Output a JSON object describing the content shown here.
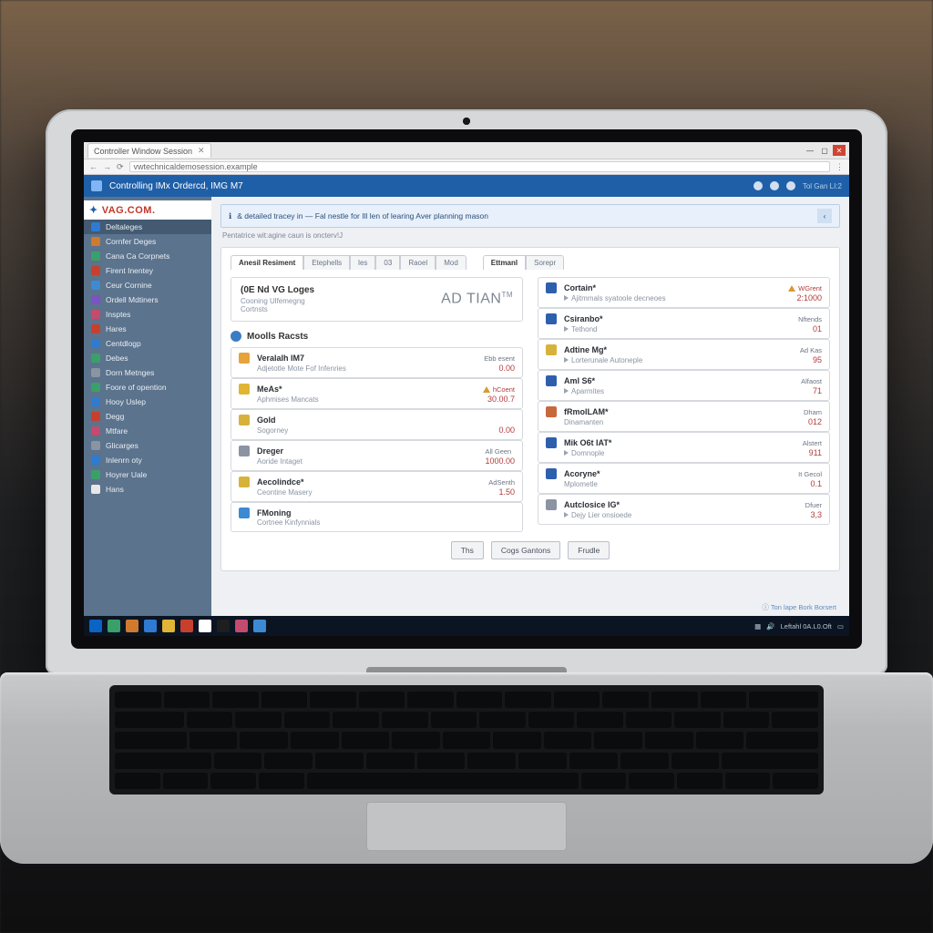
{
  "browser": {
    "tab_title": "Controller Window Session",
    "url": "vwtechnicaldemosession.example"
  },
  "window_controls": {
    "min": "—",
    "max": "▢",
    "close": "✕"
  },
  "header": {
    "title": "Controlling IMx Ordercd, IMG M7",
    "corner": "Tol Gan LI:2"
  },
  "notice": {
    "text": "& detailed tracey in — Fal nestle for Ill len of learing Aver planning mason",
    "chevron": "‹"
  },
  "subnote": "Pentatrice wit:agine caun is oncterv!J",
  "logo": {
    "text": "VAG.COM."
  },
  "sidebar": {
    "items": [
      {
        "label": "Deltaleges",
        "color": "#2e7bd1"
      },
      {
        "label": "Cornfer Deges",
        "color": "#d07a2e"
      },
      {
        "label": "Cana Ca Corpnets",
        "color": "#3aa06a"
      },
      {
        "label": "Firent Inentey",
        "color": "#c7402e"
      },
      {
        "label": "Ceur Cornine",
        "color": "#3d8ad4"
      },
      {
        "label": "Ordell Mdtiners",
        "color": "#7a54c4"
      },
      {
        "label": "Insptes",
        "color": "#c44a6e"
      },
      {
        "label": "Hares",
        "color": "#c7402e"
      },
      {
        "label": "Centdlogp",
        "color": "#2e7bd1"
      },
      {
        "label": "Debes",
        "color": "#3aa06a"
      },
      {
        "label": "Dorn Metnges",
        "color": "#8a94a3"
      },
      {
        "label": "Foore of opention",
        "color": "#3aa06a"
      },
      {
        "label": "Hooy Uslep",
        "color": "#2e7bd1"
      },
      {
        "label": "Degg",
        "color": "#c7402e"
      },
      {
        "label": "Mtfare",
        "color": "#c44a6e"
      },
      {
        "label": "Glicarges",
        "color": "#8a94a3"
      },
      {
        "label": "Inlenrn oty",
        "color": "#2e7bd1"
      },
      {
        "label": "Hoyrer Uale",
        "color": "#3aa06a"
      },
      {
        "label": "Hans",
        "color": "#e8e8e8"
      }
    ]
  },
  "panel": {
    "tabs_left": [
      "Anesil Resiment",
      "Etephells",
      "les",
      "03",
      "Raoel",
      "Mod"
    ],
    "tabs_right": [
      "Ettmanl",
      "Sorepr"
    ],
    "hero": {
      "title_prefix": "(0E Nd VG Loges",
      "subtitle_a": "Cooning Ulfemegng",
      "subtitle_b": "Cortnsts",
      "brand": "AD TIAN",
      "brand_sup": "TM"
    },
    "section_left": "Moolls Racsts",
    "left": [
      {
        "title": "Veralalh IM7",
        "sub": "Adjetotle Mote Fof Infenries",
        "badge": "Ebb esent",
        "value": "0.00",
        "icon": "#e7a23a",
        "warn": false
      },
      {
        "title": "MeAs*",
        "sub": "Aphmises Mancats",
        "badge": "hCoent",
        "value": "30.00.7",
        "icon": "#e0b536",
        "warn": true
      },
      {
        "title": "Gold",
        "sub": "Sogorney",
        "badge": "",
        "value": "0.00",
        "icon": "#d7b23a",
        "warn": false
      },
      {
        "title": "Dreger",
        "sub": "Aoride Intaget",
        "badge": "All Geen",
        "value": "1000.00",
        "icon": "#8a94a3",
        "warn": false
      },
      {
        "title": "Aecolindce*",
        "sub": "Ceontine Masery",
        "badge": "AdSenth",
        "value": "1.50",
        "icon": "#d7b23a",
        "warn": false
      },
      {
        "title": "FMoning",
        "sub": "Cortnee Kinfynnials",
        "badge": "",
        "value": "",
        "icon": "#3d8ad4",
        "warn": false
      }
    ],
    "right": [
      {
        "title": "Cortain*",
        "sub": "Ajitmmals syatoole decneoes",
        "badge": "WGrent",
        "value": "2:1000",
        "icon": "#2e5fad",
        "warn": true,
        "play": true
      },
      {
        "title": "Csiranbo*",
        "sub": "Tethond",
        "badge": "Nftends",
        "value": "01",
        "icon": "#2e5fad",
        "warn": false,
        "play": true
      },
      {
        "title": "Adtine Mg*",
        "sub": "Lorterunale Autoneple",
        "badge": "Ad Kas",
        "value": "95",
        "icon": "#d7b23a",
        "warn": false,
        "play": true
      },
      {
        "title": "Aml S6*",
        "sub": "Aparmites",
        "badge": "Alfaost",
        "value": "71",
        "icon": "#2e5fad",
        "warn": false,
        "play": true
      },
      {
        "title": "fRmolLAM*",
        "sub": "Dinamanten",
        "badge": "Dham",
        "value": "012",
        "icon": "#c7693a",
        "warn": false
      },
      {
        "title": "Mik O6t IAT*",
        "sub": "Domnople",
        "badge": "Alstert",
        "value": "911",
        "icon": "#2e5fad",
        "warn": false,
        "play": true
      },
      {
        "title": "Acoryne*",
        "sub": "Mplometle",
        "badge": "It Gecol",
        "value": "0.1",
        "icon": "#2e5fad",
        "warn": false
      },
      {
        "title": "Autclosice IG*",
        "sub": "Dejy Lier onsioede",
        "badge": "Dfuer",
        "value": "3,3",
        "icon": "#8a94a3",
        "warn": false,
        "play": true
      }
    ],
    "buttons": [
      "Ths",
      "Cogs Gantons",
      "Frudle"
    ],
    "footer": "Ton lape Bork Borsert"
  },
  "taskbar": {
    "clock": "Leftahl 0A.L0.Oft"
  },
  "sidebar_icon_colors_note": ""
}
